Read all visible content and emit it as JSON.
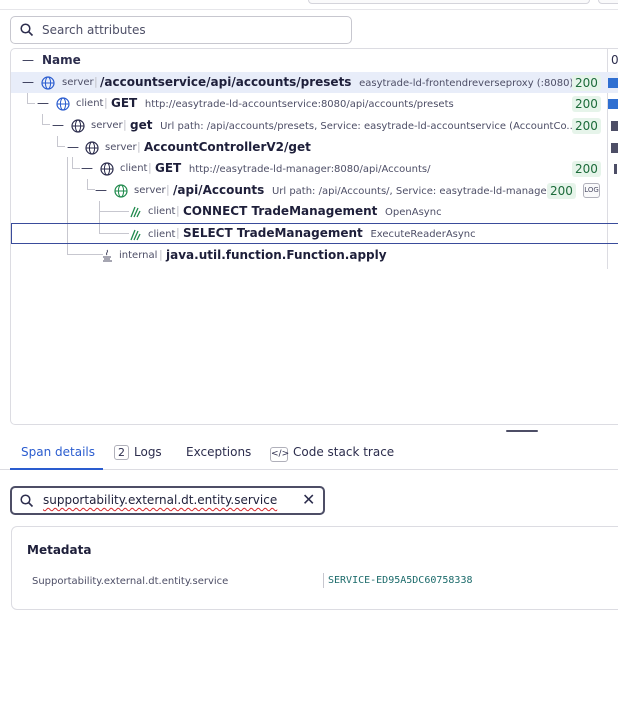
{
  "search": {
    "placeholder": "Search attributes"
  },
  "tree": {
    "header": {
      "name_label": "Name",
      "col_label": "0"
    },
    "rows": [
      {
        "kind": "server",
        "name": "/accountservice/api/accounts/presets",
        "sub": "easytrade-ld-frontendreverseproxy (:8080)",
        "status": "200"
      },
      {
        "kind": "client",
        "name": "GET",
        "sub": "http://easytrade-ld-accountservice:8080/api/accounts/presets",
        "status": "200"
      },
      {
        "kind": "server",
        "name": "get",
        "sub": "Url path: /api/accounts/presets, Service: easytrade-ld-accountservice (AccountCo...",
        "status": "200"
      },
      {
        "kind": "server",
        "name": "AccountControllerV2/get",
        "sub": "",
        "status": ""
      },
      {
        "kind": "client",
        "name": "GET",
        "sub": "http://easytrade-ld-manager:8080/api/Accounts/",
        "status": "200"
      },
      {
        "kind": "server",
        "name": "/api/Accounts",
        "sub": "Url path: /api/Accounts/, Service: easytrade-ld-manage...",
        "status": "200"
      },
      {
        "kind": "client",
        "name": "CONNECT TradeManagement",
        "sub": "OpenAsync",
        "status": ""
      },
      {
        "kind": "client",
        "name": "SELECT TradeManagement",
        "sub": "ExecuteReaderAsync",
        "status": ""
      },
      {
        "kind": "internal",
        "name": "java.util.function.Function.apply",
        "sub": "",
        "status": ""
      }
    ]
  },
  "tabs": [
    {
      "label": "Span details",
      "active": true
    },
    {
      "count": "2",
      "label": "Logs"
    },
    {
      "label": "Exceptions"
    },
    {
      "icon": "code-icon",
      "label": "Code stack trace"
    }
  ],
  "filter": {
    "value": "supportability.external.dt.entity.service"
  },
  "metadata": {
    "title": "Metadata",
    "key": "Supportability.external.dt.entity.service",
    "value": "SERVICE-ED95A5DC60758338"
  },
  "colors": {
    "accent": "#2a5ccf",
    "status_ok": "#1c6b3a",
    "bar_blue": "#2f6fd1",
    "bar_dark": "#4d4e66"
  }
}
